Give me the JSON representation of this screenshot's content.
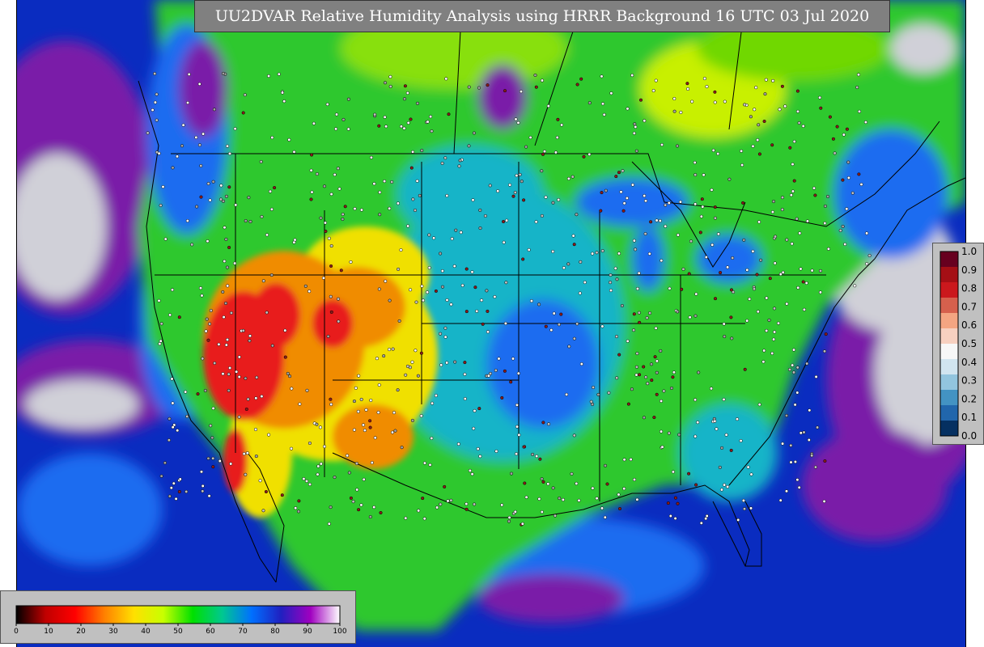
{
  "title": "UU2DVAR Relative Humidity Analysis using HRRR Background 16 UTC 03 Jul 2020",
  "colors": {
    "ocean": "#0a2cc0",
    "canada_green": "#2ec82e",
    "dry_red": "#e81a1a",
    "dry_orange": "#f08c00",
    "dry_yellow": "#f0e000",
    "wet_blue": "#1e6cf0",
    "cyan": "#18b4c8",
    "purple": "#7a1aa8",
    "white_grey": "#d0d0d8",
    "panel_grey": "#c0c0c0",
    "title_bar": "#808080"
  },
  "rh_colorbar": {
    "tick_labels": [
      "0",
      "10",
      "20",
      "30",
      "40",
      "50",
      "60",
      "70",
      "80",
      "90",
      "100"
    ],
    "stops": [
      "#000000",
      "#c00000",
      "#ff0000",
      "#ff8000",
      "#ffe000",
      "#c8ff00",
      "#00e000",
      "#00c890",
      "#0070ff",
      "#2020c0",
      "#a000c0",
      "#ffffff"
    ]
  },
  "ratio_legend": {
    "tick_labels": [
      "1.0",
      "0.9",
      "0.8",
      "0.7",
      "0.6",
      "0.5",
      "0.4",
      "0.3",
      "0.2",
      "0.1",
      "0.0"
    ],
    "colors": [
      "#67001f",
      "#a50f15",
      "#cb181d",
      "#d6604d",
      "#f4a582",
      "#f7d0c0",
      "#f7f7f7",
      "#d1e5f0",
      "#92c5de",
      "#4393c3",
      "#2166ac",
      "#053061"
    ]
  }
}
